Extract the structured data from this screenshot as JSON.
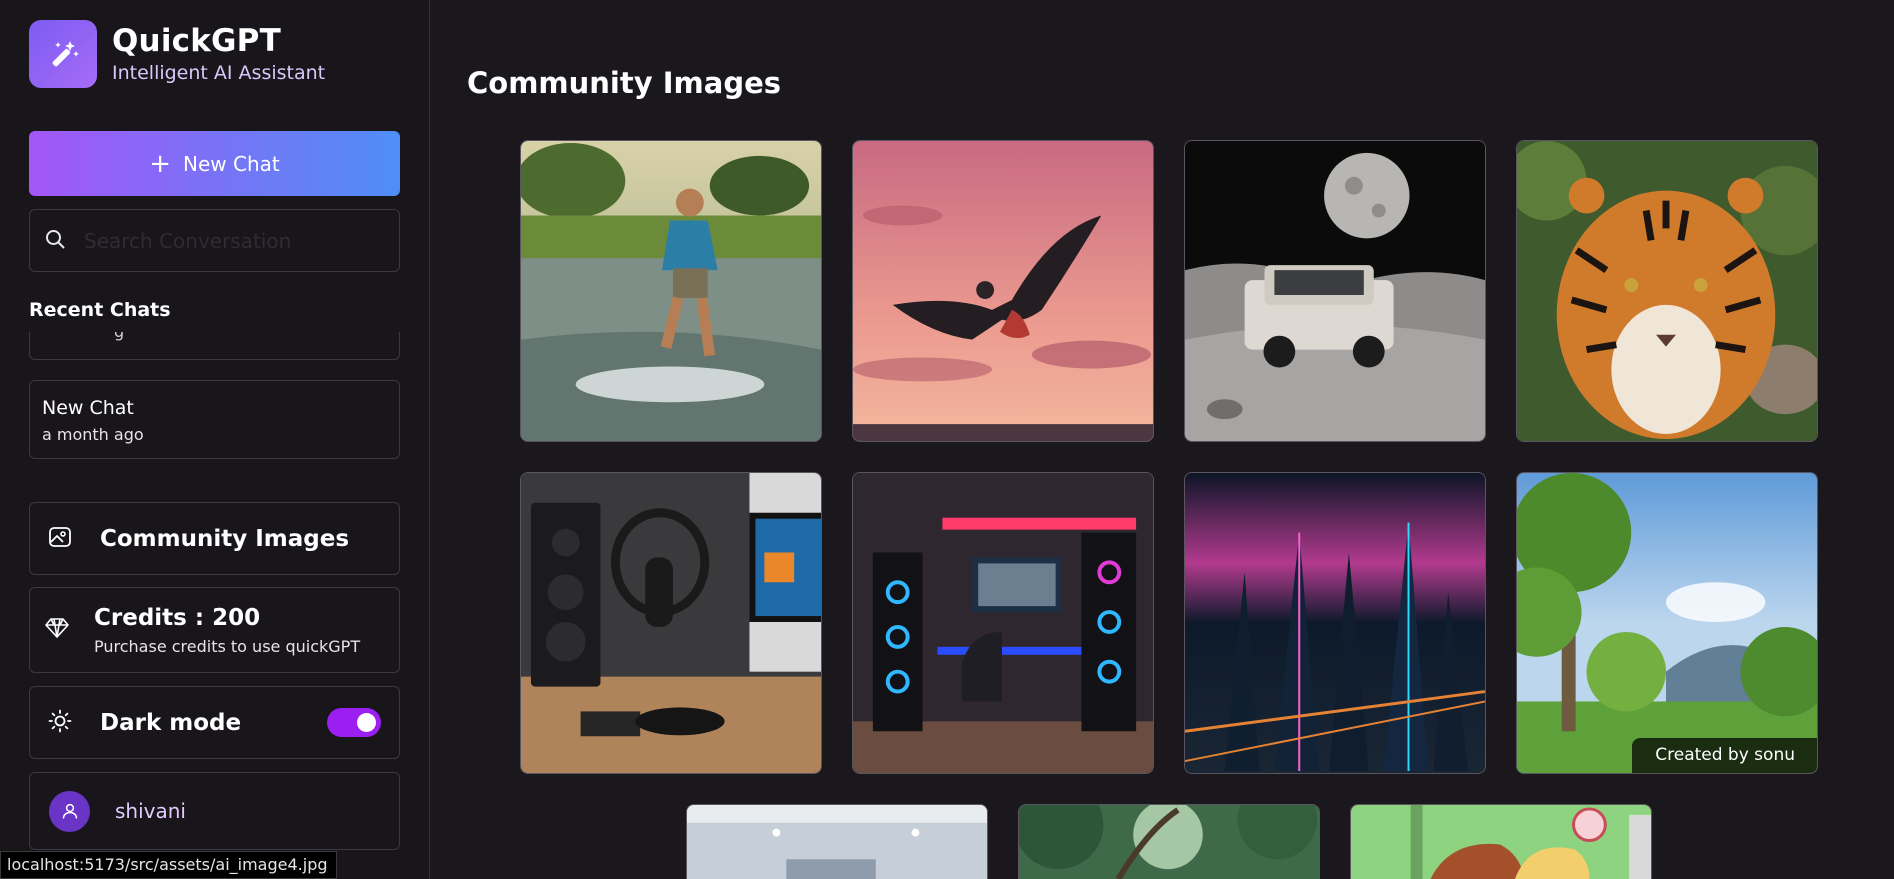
{
  "app": {
    "name": "QuickGPT",
    "tagline": "Intelligent AI Assistant",
    "accent": "#a456f7",
    "accent_to": "#4f8ef6"
  },
  "sidebar": {
    "new_chat_label": "New Chat",
    "search_placeholder": "Search Conversation",
    "search_value": "",
    "recent_title": "Recent Chats",
    "recent_chats": [
      {
        "title": "New Chat",
        "time": "a month ago"
      }
    ],
    "community_label": "Community Images",
    "credits_label": "Credits : 200",
    "credits_sub": "Purchase credits to use quickGPT",
    "dark_mode_label": "Dark mode",
    "dark_mode_on": true,
    "user_name": "shivani"
  },
  "main": {
    "title": "Community Images",
    "images": [
      {
        "subject": "boy running in water"
      },
      {
        "subject": "eagle flying at sunset"
      },
      {
        "subject": "car on moon surface"
      },
      {
        "subject": "tiger portrait"
      },
      {
        "subject": "studio desk with microphone"
      },
      {
        "subject": "neon gaming setup"
      },
      {
        "subject": "neon city aerial"
      },
      {
        "subject": "trees in park",
        "badge": "Created by sonu"
      },
      {
        "subject": "room interior"
      },
      {
        "subject": "jungle trees"
      },
      {
        "subject": "anime characters"
      }
    ]
  },
  "status_bar": {
    "url": "localhost:5173/src/assets/ai_image4.jpg"
  }
}
